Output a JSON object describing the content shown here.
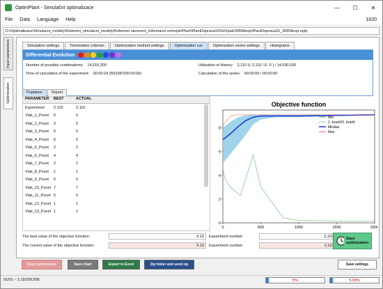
{
  "window": {
    "title": "OptimPlant - Simulační optimalizace",
    "minimize": "—",
    "maximize": "☐",
    "close": "✕"
  },
  "menu": {
    "file": "File",
    "data": "Data",
    "language": "Language",
    "help": "Help",
    "right_value": "1620"
  },
  "path": "D:\\Optimalizace\\Simulacni_modely\\Diskretni_simulacni_modely\\Kriterium ukonceni_Informacni entropie\\Plant\\PlantDoprava15\\5xOpak\\39558exp\\PlantDoprava15_39558exp.optp",
  "vtabs": {
    "input": "Input parameters",
    "optim": "Optimization"
  },
  "tabs": [
    "Simulation settings",
    "Termination criterion",
    "Optimization method settings",
    "Optimization run",
    "Optimization series settings",
    "Histograms"
  ],
  "active_tab": 3,
  "de": {
    "title": "Differential Evolution",
    "dot_colors": [
      "#e02020",
      "#f08a00",
      "#f5d200",
      "#2aa02a",
      "#1a4fd6",
      "#7a2ad6",
      "#c070e0"
    ],
    "combos_label": "Number of possible combinations:",
    "combos_value": "14,515,200",
    "time_label": "Time of calculation of the experiment:",
    "time_value": "00:00:24.3551687(00:00:00)",
    "history_label": "Utilization of History:",
    "history_value": "2,110   (I:  2,110  / E:  0  )   /   14,530,530",
    "series_label": "Calculation of the series:",
    "series_value": "00:00:00     /     00:00:00"
  },
  "subtabs": [
    "Poplation",
    "Report"
  ],
  "table": {
    "headers": [
      "PARAMETER",
      "BEST",
      "ACTUAL"
    ],
    "rows": [
      [
        "Experiment",
        "2,102",
        "2,110"
      ],
      [
        "Vlak_1_Pocet",
        "5",
        "5"
      ],
      [
        "Vlak_2_Pocet",
        "3",
        "5"
      ],
      [
        "Vlak_3_Pocet",
        "5",
        "5"
      ],
      [
        "Vlak_4_Pocet",
        "6",
        "6"
      ],
      [
        "Vlak_5_Pocet",
        "2",
        "2"
      ],
      [
        "Vlak_6_Pocet",
        "4",
        "4"
      ],
      [
        "Vlak_7_Pocet",
        "2",
        "2"
      ],
      [
        "Vlak_8_Pocet",
        "1",
        "1"
      ],
      [
        "Vlak_9_Pocet",
        "5",
        "5"
      ],
      [
        "Vlak_10_Pocet",
        "7",
        "7"
      ],
      [
        "Vlak_11_Pocet",
        "5",
        "5"
      ],
      [
        "Vlak_12_Pocet",
        "1",
        "1"
      ],
      [
        "Vlak_13_Pocet",
        "1",
        "1"
      ]
    ]
  },
  "chart_data": {
    "type": "line",
    "title": "Objective function",
    "xlim": [
      0,
      2000
    ],
    "ylim": [
      0,
      9.5
    ],
    "x_ticks": [
      "0",
      "500",
      "1000",
      "1500",
      "2000"
    ],
    "y_ticks": [
      "0",
      "2",
      "4",
      "6",
      "8"
    ],
    "legend": [
      "Min",
      "1. kvartil/3. kvartil",
      "Median",
      "Max"
    ],
    "legend_position": "right",
    "series": [
      {
        "name": "Min",
        "color": "#4caf50",
        "x": [
          0,
          40,
          100,
          230,
          400,
          500,
          650,
          800,
          1000,
          1500,
          2000
        ],
        "y": [
          4.5,
          3.5,
          3.0,
          2.3,
          5.7,
          3.0,
          1.7,
          0.4,
          0.2,
          0.15,
          0.15
        ]
      },
      {
        "name": "Median",
        "color": "#1a3fd6",
        "x": [
          0,
          100,
          200,
          300,
          400,
          500,
          700,
          1000,
          1500,
          2000
        ],
        "y": [
          7.0,
          7.5,
          8.1,
          8.6,
          8.9,
          9.0,
          9.0,
          9.0,
          9.05,
          9.1
        ]
      },
      {
        "name": "Max",
        "color": "#e06060",
        "x": [
          0,
          100,
          200,
          300,
          400,
          500,
          700,
          1000,
          1500,
          2000
        ],
        "y": [
          8.2,
          9.0,
          9.1,
          9.1,
          9.1,
          9.1,
          9.1,
          9.1,
          9.1,
          9.1
        ]
      },
      {
        "name": "1. kvartil/3. kvartil",
        "color": "#8ecde8",
        "x": [
          0,
          100,
          200,
          300,
          400,
          500,
          700,
          1000,
          1500,
          2000
        ],
        "y_low": [
          5.0,
          5.8,
          6.6,
          7.4,
          8.3,
          8.7,
          8.9,
          8.9,
          9.0,
          9.05
        ],
        "y_high": [
          8.0,
          8.5,
          8.9,
          9.05,
          9.1,
          9.1,
          9.1,
          9.1,
          9.1,
          9.1
        ]
      }
    ]
  },
  "values": {
    "best_label": "The best value of the objective function:",
    "best_value": "9.10",
    "current_label": "The current value of the objective function:",
    "current_value": "9.10",
    "exp_label": "Experiment number:",
    "best_exp": "2,102",
    "current_exp": "2,110"
  },
  "start_button": "Start optimization",
  "bottom": {
    "stop": "Stop optimization",
    "save_chart": "Save chart",
    "export": "Export to Excel",
    "zip": "Zip folder and send zip",
    "save_settings": "Save settings"
  },
  "status": {
    "left": "01/01 – 2,110/39,558",
    "progress1": "5%",
    "progress1_fraction": 0.05,
    "progress2": "5.00%",
    "progress2_fraction": 0.05
  },
  "colors": {
    "accent": "#4a90d9",
    "start": "#5ec88a",
    "stop": "#e59a9a",
    "save_chart": "#7a7a7a",
    "export": "#2f7a48",
    "zip": "#2a4f8a"
  }
}
